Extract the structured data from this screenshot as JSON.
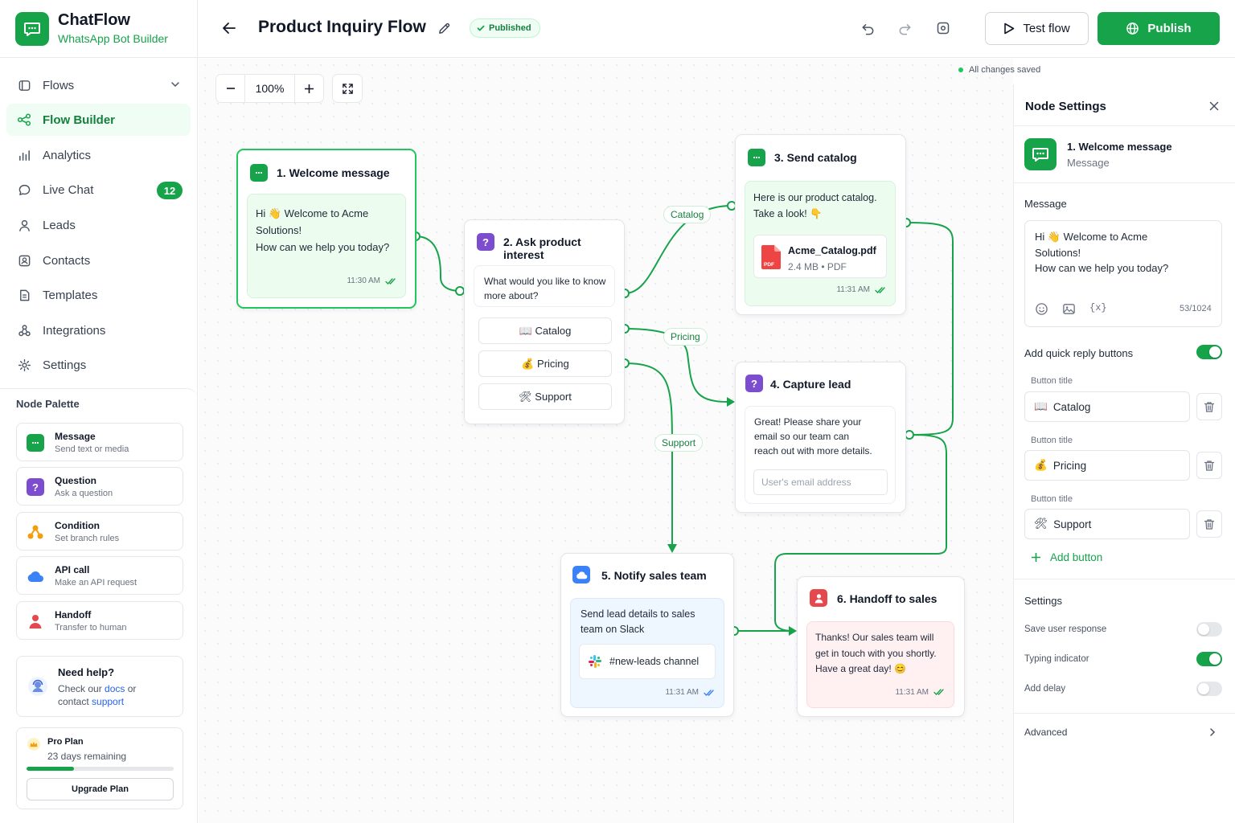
{
  "brand": {
    "name": "ChatFlow",
    "subtitle": "WhatsApp Bot Builder"
  },
  "nav": [
    {
      "label": "Flows",
      "icon": "flows-icon"
    },
    {
      "label": "Flow Builder",
      "icon": "flow-builder-icon",
      "active": true
    },
    {
      "label": "Analytics",
      "icon": "analytics-icon"
    },
    {
      "label": "Live Chat",
      "icon": "chat-icon",
      "badge": "12"
    },
    {
      "label": "Leads",
      "icon": "user-icon"
    },
    {
      "label": "Contacts",
      "icon": "contacts-icon"
    },
    {
      "label": "Templates",
      "icon": "templates-icon"
    },
    {
      "label": "Integrations",
      "icon": "integrations-icon"
    },
    {
      "label": "Settings",
      "icon": "gear-icon"
    }
  ],
  "palette": {
    "title": "Node Palette",
    "items": [
      {
        "name": "Message",
        "desc": "Send text or media"
      },
      {
        "name": "Question",
        "desc": "Ask a question"
      },
      {
        "name": "Condition",
        "desc": "Set branch rules"
      },
      {
        "name": "API call",
        "desc": "Make an API request"
      },
      {
        "name": "Handoff",
        "desc": "Transfer to human"
      }
    ]
  },
  "help": {
    "title": "Need help?",
    "text_1": "Check our ",
    "docs": "docs",
    "text_2": " or",
    "text_3": "contact ",
    "support": "support"
  },
  "plan": {
    "name": "Pro Plan",
    "days": "23 days remaining",
    "progress": 0.32,
    "upgrade": "Upgrade Plan"
  },
  "header": {
    "title": "Product Inquiry Flow",
    "status": "Published",
    "test": "Test flow",
    "publish": "Publish"
  },
  "canvas": {
    "zoom": "100%",
    "saved": "All changes saved"
  },
  "nodes": {
    "n1": {
      "title": "1. Welcome message",
      "line1": "Hi 👋 Welcome to Acme",
      "line2": "Solutions!",
      "line3": "How can we help you today?",
      "time": "11:30 AM"
    },
    "n2": {
      "title": "2. Ask product interest",
      "line1": "What would you like to know",
      "line2": "more about?",
      "buttons": [
        "📖 Catalog",
        "💰 Pricing",
        "🛠 Support"
      ]
    },
    "n3": {
      "title": "3. Send catalog",
      "line1": "Here is our product catalog.",
      "line2": "Take a look! 👇",
      "file_name": "Acme_Catalog.pdf",
      "file_meta": "2.4 MB • PDF",
      "file_badge": "PDF",
      "time": "11:31 AM"
    },
    "n4": {
      "title": "4. Capture lead",
      "line1": "Great! Please share your",
      "line2": "email so our team can",
      "line3": "reach out with more details.",
      "placeholder": "User's email address"
    },
    "n5": {
      "title": "5. Notify sales team",
      "line1": "Send lead details to sales",
      "line2": "team on Slack",
      "channel": "#new-leads channel",
      "time": "11:31 AM"
    },
    "n6": {
      "title": "6. Handoff to sales",
      "line1": "Thanks! Our sales team will",
      "line2": "get in touch with you shortly.",
      "line3": "Have a great day! 😊",
      "time": "11:31 AM"
    }
  },
  "edges": {
    "catalog": "Catalog",
    "pricing": "Pricing",
    "support": "Support"
  },
  "panel": {
    "title": "Node Settings",
    "node_name": "1. Welcome message",
    "node_type": "Message",
    "message_label": "Message",
    "message_line1": "Hi 👋 Welcome to Acme",
    "message_line2": "Solutions!",
    "message_line3": "How can we help you today?",
    "char_count": "53/1024",
    "quick_reply_label": "Add quick reply buttons",
    "quick_reply_on": true,
    "button_title_label": "Button title",
    "buttons": [
      {
        "emoji": "📖",
        "text": "Catalog"
      },
      {
        "emoji": "💰",
        "text": "Pricing"
      },
      {
        "emoji": "🛠",
        "text": "Support"
      }
    ],
    "add_button": "Add button",
    "settings_label": "Settings",
    "settings": [
      {
        "label": "Save user response",
        "on": false
      },
      {
        "label": "Typing indicator",
        "on": true
      },
      {
        "label": "Add delay",
        "on": false
      }
    ],
    "advanced": "Advanced"
  },
  "colors": {
    "brand": "#16a34a",
    "question": "#7c4dce",
    "condition": "#f59e0b",
    "api": "#3b82f6",
    "handoff": "#e5484d"
  }
}
